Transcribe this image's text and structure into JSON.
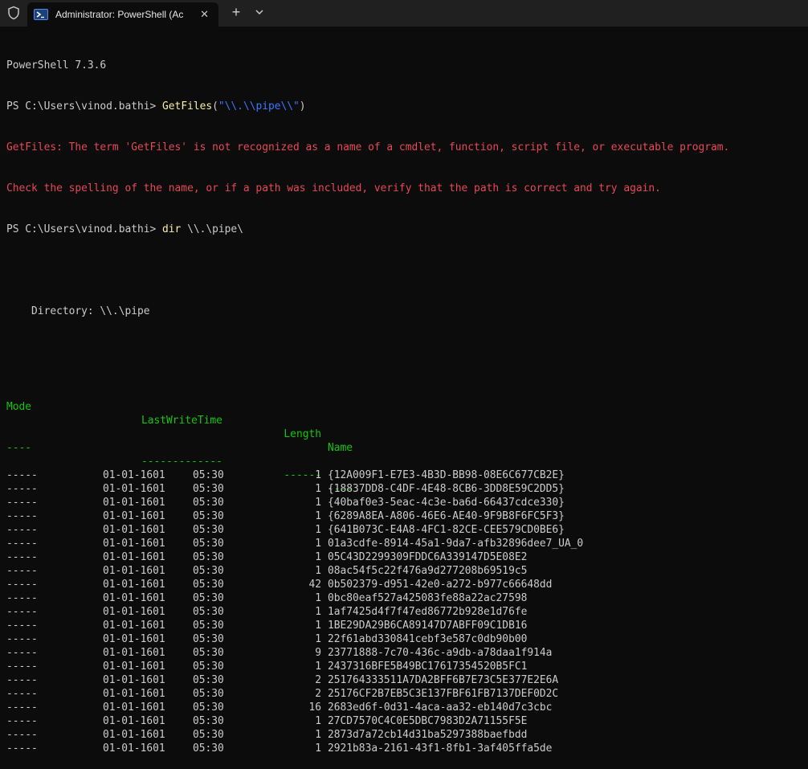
{
  "window": {
    "tab_title": "Administrator: PowerShell (Ac",
    "close_glyph": "✕",
    "newtab_glyph": "+",
    "icons": [
      "shield-icon",
      "powershell-icon",
      "close-icon",
      "plus-icon",
      "chevron-down-icon"
    ]
  },
  "terminal": {
    "version_line": "PowerShell 7.3.6",
    "prompt1": "PS C:\\Users\\vinod.bathi> ",
    "cmd1_name": "GetFiles",
    "cmd1_open": "(",
    "cmd1_arg": "\"\\\\.\\\\pipe\\\\\"",
    "cmd1_close": ")",
    "error1": "GetFiles: The term 'GetFiles' is not recognized as a name of a cmdlet, function, script file, or executable program.",
    "error2": "Check the spelling of the name, or if a path was included, verify that the path is correct and try again.",
    "prompt2": "PS C:\\Users\\vinod.bathi> ",
    "cmd2_name": "dir",
    "cmd2_arg": " \\\\.\\pipe\\",
    "directory_line": "    Directory: \\\\.\\pipe",
    "headers": {
      "mode": "Mode",
      "lastwritetime": "LastWriteTime",
      "length": "Length",
      "name": "Name"
    },
    "underlines": {
      "mode": "----",
      "lastwritetime": "-------------",
      "length": "------",
      "name": "----"
    },
    "rows": [
      {
        "mode": "-----",
        "date": "01-01-1601",
        "time": "05:30",
        "length": "1",
        "name": "{12A009F1-E7E3-4B3D-BB98-08E6C677CB2E}"
      },
      {
        "mode": "-----",
        "date": "01-01-1601",
        "time": "05:30",
        "length": "1",
        "name": "{18837DD8-C4DF-4E48-8CB6-3DD8E59C2DD5}"
      },
      {
        "mode": "-----",
        "date": "01-01-1601",
        "time": "05:30",
        "length": "1",
        "name": "{40baf0e3-5eac-4c3e-ba6d-66437cdce330}"
      },
      {
        "mode": "-----",
        "date": "01-01-1601",
        "time": "05:30",
        "length": "1",
        "name": "{6289A8EA-A806-46E6-AE40-9F9B8F6FC5F3}"
      },
      {
        "mode": "-----",
        "date": "01-01-1601",
        "time": "05:30",
        "length": "1",
        "name": "{641B073C-E4A8-4FC1-82CE-CEE579CD0BE6}"
      },
      {
        "mode": "-----",
        "date": "01-01-1601",
        "time": "05:30",
        "length": "1",
        "name": "01a3cdfe-8914-45a1-9da7-afb32896dee7_UA_0"
      },
      {
        "mode": "-----",
        "date": "01-01-1601",
        "time": "05:30",
        "length": "1",
        "name": "05C43D2299309FDDC6A339147D5E08E2"
      },
      {
        "mode": "-----",
        "date": "01-01-1601",
        "time": "05:30",
        "length": "1",
        "name": "08ac54f5c22f476a9d277208b69519c5"
      },
      {
        "mode": "-----",
        "date": "01-01-1601",
        "time": "05:30",
        "length": "42",
        "name": "0b502379-d951-42e0-a272-b977c66648dd"
      },
      {
        "mode": "-----",
        "date": "01-01-1601",
        "time": "05:30",
        "length": "1",
        "name": "0bc80eaf527a425083fe88a22ac27598"
      },
      {
        "mode": "-----",
        "date": "01-01-1601",
        "time": "05:30",
        "length": "1",
        "name": "1af7425d4f7f47ed86772b928e1d76fe"
      },
      {
        "mode": "-----",
        "date": "01-01-1601",
        "time": "05:30",
        "length": "1",
        "name": "1BE29DA29B6CA89147D7ABFF09C1DB16"
      },
      {
        "mode": "-----",
        "date": "01-01-1601",
        "time": "05:30",
        "length": "1",
        "name": "22f61abd330841cebf3e587c0db90b00"
      },
      {
        "mode": "-----",
        "date": "01-01-1601",
        "time": "05:30",
        "length": "9",
        "name": "23771888-7c70-436c-a9db-a78daa1f914a"
      },
      {
        "mode": "-----",
        "date": "01-01-1601",
        "time": "05:30",
        "length": "1",
        "name": "2437316BFE5B49BC17617354520B5FC1"
      },
      {
        "mode": "-----",
        "date": "01-01-1601",
        "time": "05:30",
        "length": "2",
        "name": "251764333511A7DA2BFF6B7E73C5E377E2E6A"
      },
      {
        "mode": "-----",
        "date": "01-01-1601",
        "time": "05:30",
        "length": "2",
        "name": "25176CF2B7EB5C3E137FBF61FB7137DEF0D2C"
      },
      {
        "mode": "-----",
        "date": "01-01-1601",
        "time": "05:30",
        "length": "16",
        "name": "2683ed6f-0d31-4aca-aa32-eb140d7c3cbc"
      },
      {
        "mode": "-----",
        "date": "01-01-1601",
        "time": "05:30",
        "length": "1",
        "name": "27CD7570C4C0E5DBC7983D2A71155F5E"
      },
      {
        "mode": "-----",
        "date": "01-01-1601",
        "time": "05:30",
        "length": "1",
        "name": "2873d7a72cb14d31ba5297388baefbdd"
      },
      {
        "mode": "-----",
        "date": "01-01-1601",
        "time": "05:30",
        "length": "1",
        "name": "2921b83a-2161-43f1-8fb1-3af405ffa5de"
      }
    ]
  }
}
